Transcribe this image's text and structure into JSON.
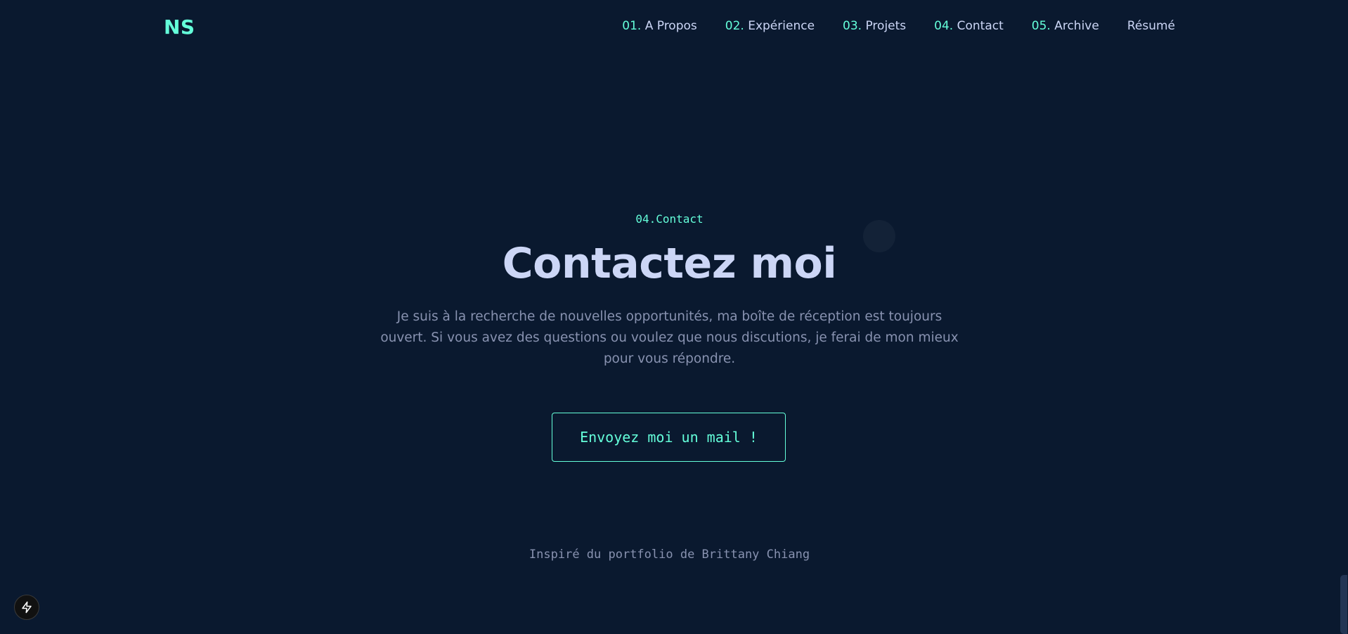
{
  "header": {
    "logo": "NS",
    "nav": [
      {
        "num": "01.",
        "label": "A Propos"
      },
      {
        "num": "02.",
        "label": "Expérience"
      },
      {
        "num": "03.",
        "label": "Projets"
      },
      {
        "num": "04.",
        "label": "Contact"
      },
      {
        "num": "05.",
        "label": "Archive"
      }
    ],
    "resume_label": "Résumé"
  },
  "contact": {
    "overline": "04.Contact",
    "title": "Contactez moi",
    "description": "Je suis à la recherche de nouvelles opportunités, ma boîte de réception est toujours ouvert. Si vous avez des questions ou voulez que nous discutions, je ferai de mon mieux pour vous répondre.",
    "button_label": "Envoyez moi un mail !"
  },
  "footer": {
    "credit": "Inspiré du portfolio de Brittany Chiang"
  },
  "colors": {
    "background": "#0a192f",
    "accent": "#64ffda",
    "heading": "#ccd6f6",
    "body_text": "#8892b0"
  },
  "icons": {
    "dev_badge": "lightning-bolt-icon"
  }
}
